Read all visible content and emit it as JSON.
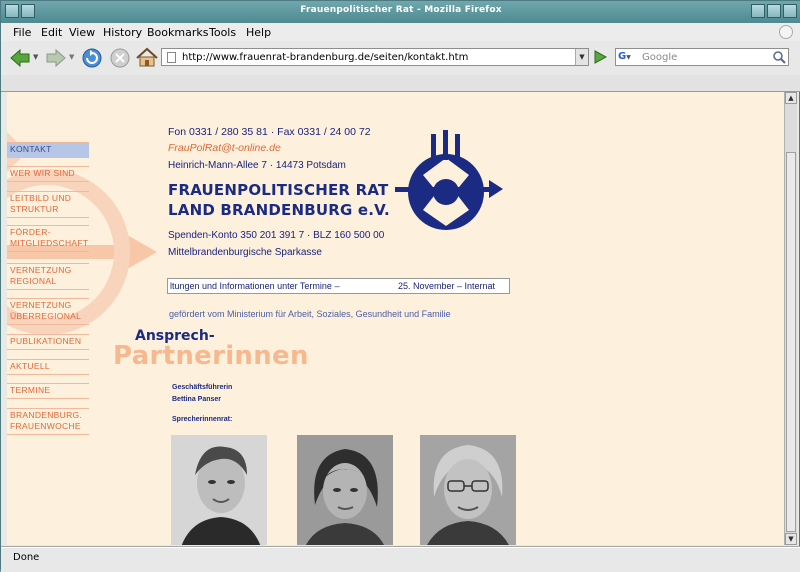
{
  "window": {
    "title": "Frauenpolitischer Rat - Mozilla Firefox"
  },
  "menu": [
    {
      "label": "File"
    },
    {
      "label": "Edit"
    },
    {
      "label": "View"
    },
    {
      "label": "History"
    },
    {
      "label": "Bookmarks"
    },
    {
      "label": "Tools"
    },
    {
      "label": "Help"
    }
  ],
  "toolbar": {
    "url": "http://www.frauenrat-brandenburg.de/seiten/kontakt.htm",
    "search_placeholder": "Google",
    "icons": [
      "back-icon",
      "forward-icon",
      "reload-icon",
      "stop-icon",
      "home-icon",
      "go-icon",
      "google-icon",
      "search-icon"
    ]
  },
  "sidebar": {
    "items": [
      {
        "line1": "KONTAKT",
        "line2": ""
      },
      {
        "line1": "WER WIR SIND",
        "line2": ""
      },
      {
        "line1": "LEITBILD UND",
        "line2": "STRUKTUR"
      },
      {
        "line1": "FÖRDER-",
        "line2": "MITGLIEDSCHAFT"
      },
      {
        "line1": "VERNETZUNG",
        "line2": "REGIONAL"
      },
      {
        "line1": "VERNETZUNG",
        "line2": "ÜBERREGIONAL"
      },
      {
        "line1": "PUBLIKATIONEN",
        "line2": ""
      },
      {
        "line1": "AKTUELL",
        "line2": ""
      },
      {
        "line1": "TERMINE",
        "line2": ""
      },
      {
        "line1": "BRANDENBURG.",
        "line2": "FRAUENWOCHE"
      }
    ]
  },
  "contact": {
    "phone": "Fon 0331 / 280 35 81 · Fax 0331 / 24 00 72",
    "email": "FrauPolRat@t-online.de",
    "address": "Heinrich-Mann-Allee 7 · 14473 Potsdam",
    "org_line1": "FRAUENPOLITISCHER RAT",
    "org_line2": "LAND BRANDENBURG e.V.",
    "bank": "Spenden-Konto 350 201 391 7 · BLZ 160 500 00",
    "bank_name": "Mittelbrandenburgische Sparkasse"
  },
  "ticker": {
    "left": "ltungen und Informationen unter Termine –",
    "right": "25. November – Internat"
  },
  "funding": "gefördert vom Ministerium für Arbeit, Soziales, Gesundheit und Familie",
  "page": {
    "heading_line1": "Ansprech-",
    "heading_line2": "Partnerinnen",
    "manager_label": "Geschäftsführerin",
    "manager_name": "Bettina Panser",
    "council_label": "Sprecherinnenrat:"
  },
  "status": {
    "text": "Done"
  },
  "colors": {
    "accent": "#1b2a82",
    "orange": "#e2683a",
    "page_bg": "#fdf0dc"
  }
}
